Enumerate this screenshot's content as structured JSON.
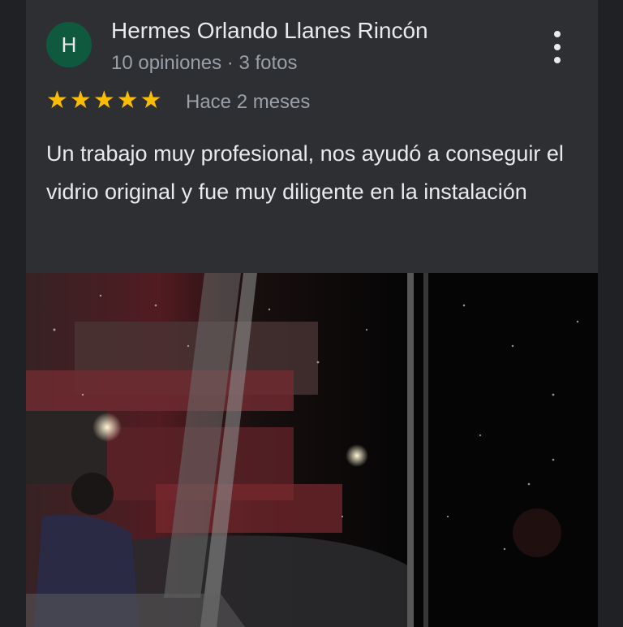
{
  "review": {
    "avatar_letter": "H",
    "author_name": "Hermes Orlando Llanes Rincón",
    "author_meta": "10 opiniones · 3 fotos",
    "rating": 5,
    "time_ago": "Hace 2 meses",
    "text": "Un trabajo muy profesional, nos ayudó a conseguir el vidrio original y fue muy diligente en la instalación",
    "photo_icon": "review-photo"
  },
  "colors": {
    "background": "#202124",
    "card": "#2d2f33",
    "avatar": "#0f5a3f",
    "star": "#fbbc04",
    "primary_text": "#e8eaed",
    "secondary_text": "#9aa0a6"
  }
}
